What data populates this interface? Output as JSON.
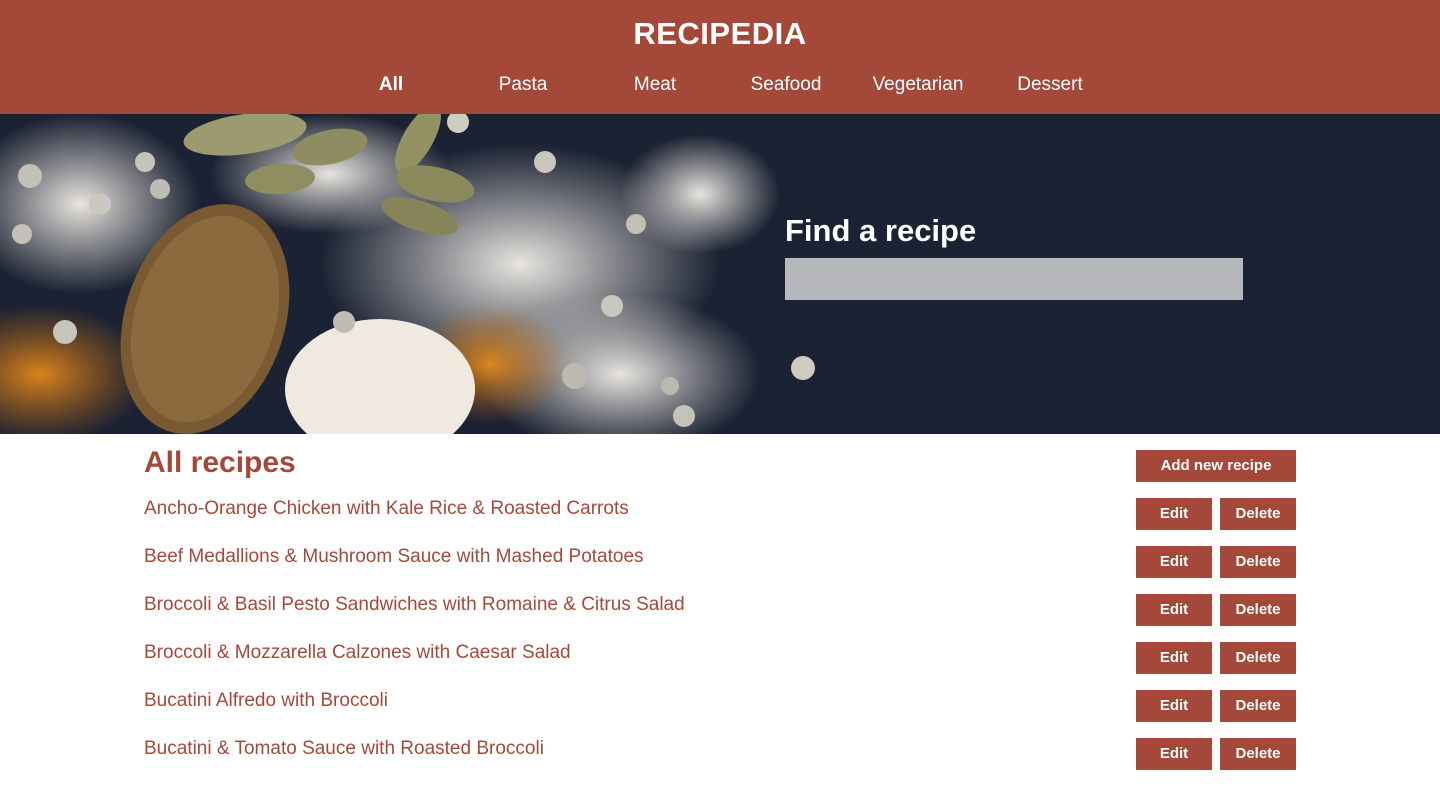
{
  "header": {
    "title": "RECIPEDIA",
    "nav": [
      "All",
      "Pasta",
      "Meat",
      "Seafood",
      "Vegetarian",
      "Dessert"
    ],
    "active_nav": "All"
  },
  "search": {
    "title": "Find a recipe",
    "value": "",
    "placeholder": ""
  },
  "recipes": {
    "title": "All recipes",
    "add_label": "Add new recipe",
    "edit_label": "Edit",
    "delete_label": "Delete",
    "items": [
      "Ancho-Orange Chicken with Kale Rice & Roasted Carrots",
      "Beef Medallions & Mushroom Sauce with Mashed Potatoes",
      "Broccoli & Basil Pesto Sandwiches with Romaine & Citrus Salad",
      "Broccoli & Mozzarella Calzones with Caesar Salad",
      "Bucatini Alfredo with Broccoli",
      "Bucatini & Tomato Sauce with Roasted Broccoli"
    ]
  },
  "colors": {
    "brand": "#a4493a",
    "hero_bg": "#1b2233",
    "search_bg": "#b5b7bb"
  }
}
